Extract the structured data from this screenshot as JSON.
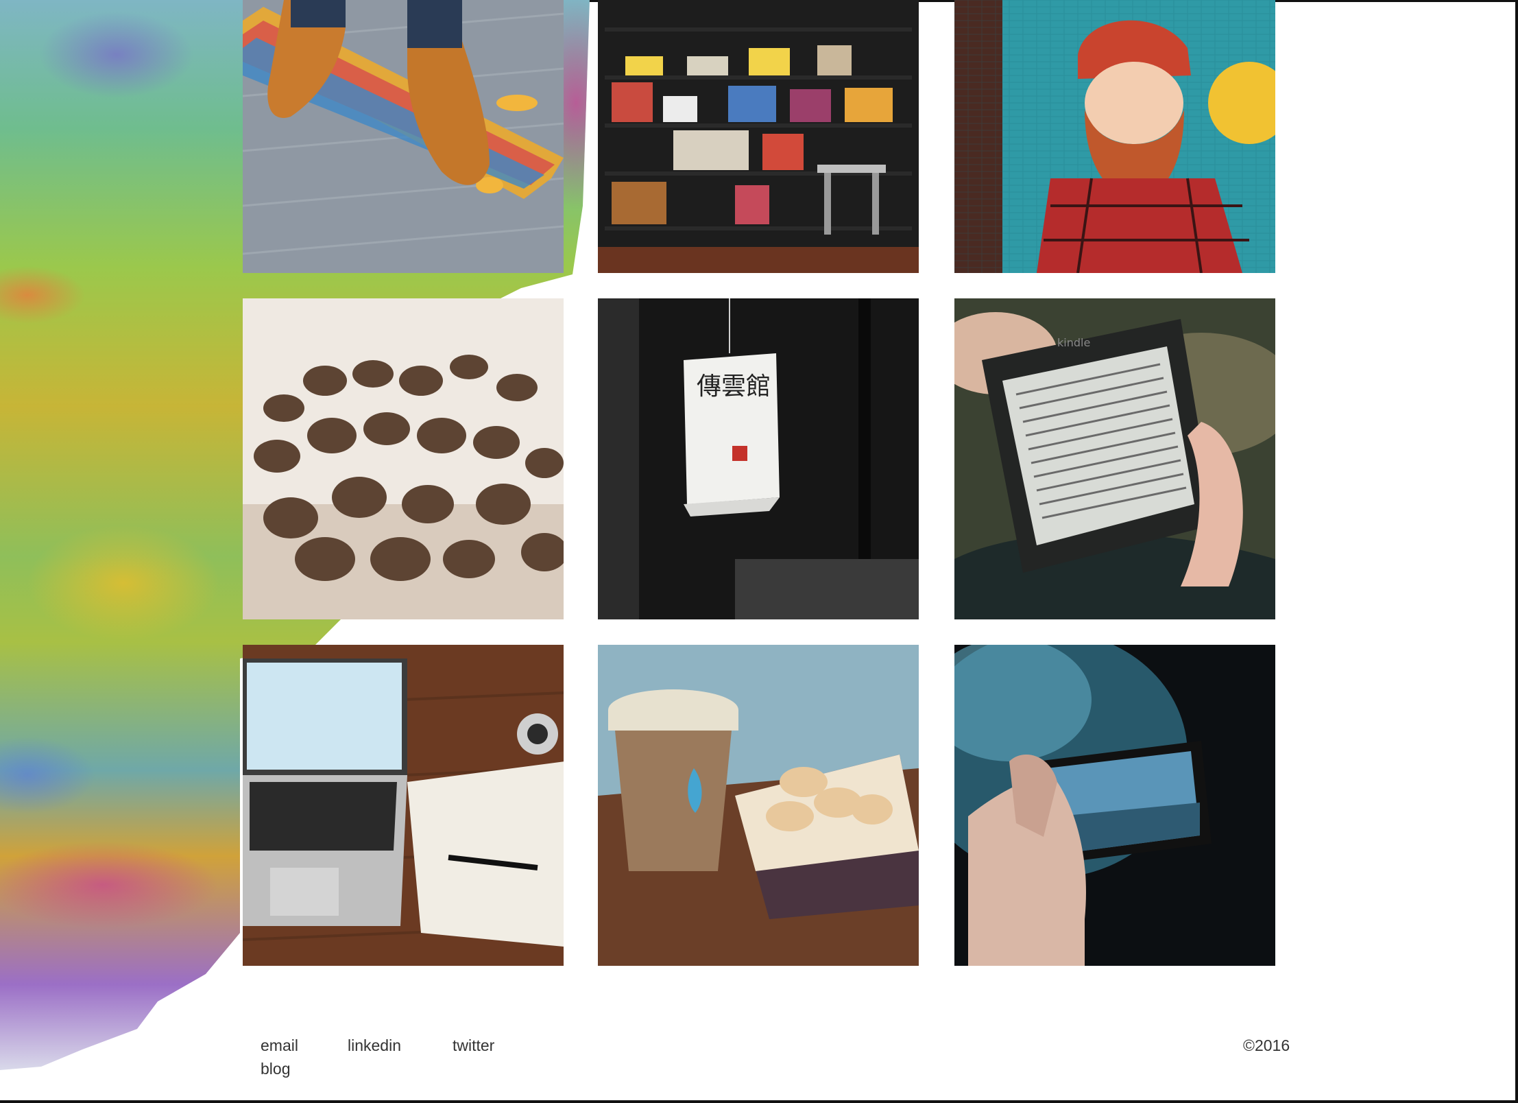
{
  "gallery": {
    "tiles": [
      {
        "name": "skateboard-shoes-photo"
      },
      {
        "name": "bookshelf-photo"
      },
      {
        "name": "bearded-man-mural-photo"
      },
      {
        "name": "coffee-beans-photo"
      },
      {
        "name": "paper-lantern-photo",
        "lantern_text": "傳雲館"
      },
      {
        "name": "kindle-reader-photo",
        "device_label": "kindle"
      },
      {
        "name": "laptop-notebook-photo"
      },
      {
        "name": "coffee-cup-macarons-photo"
      },
      {
        "name": "phone-photo-city-photo"
      }
    ]
  },
  "footer": {
    "links": {
      "email": "email",
      "linkedin": "linkedin",
      "twitter": "twitter",
      "blog": "blog"
    },
    "copyright": "©2016"
  },
  "colors": {
    "background": "#ffffff",
    "footer_text": "#333333",
    "frame": "#111111"
  }
}
